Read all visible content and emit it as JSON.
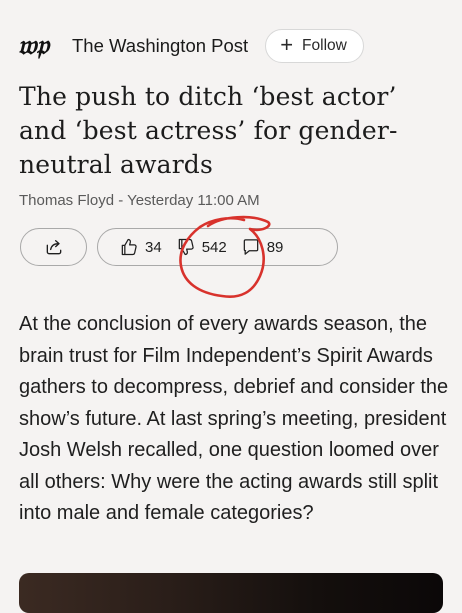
{
  "publisher": {
    "logo_text": "wp",
    "name": "The Washington Post",
    "follow_label": "Follow"
  },
  "article": {
    "headline": "The push to ditch ‘best actor’ and ‘best actress’ for gender-neutral awards",
    "byline": "Thomas Floyd - Yesterday 11:00 AM",
    "body": "At the conclusion of every awards season, the brain trust for Film Independent’s Spirit Awards gathers to decompress, debrief and consider the show’s future. At last spring’s meeting, president Josh Welsh recalled, one question loomed over all others: Why were the acting awards still split into male and female categories?"
  },
  "actions": {
    "likes": "34",
    "dislikes": "542",
    "comments": "89",
    "share_icon": "share-icon",
    "like_icon": "thumbs-up-icon",
    "dislike_icon": "thumbs-down-icon",
    "comment_icon": "comment-icon"
  },
  "colors": {
    "background": "#f5f3f2",
    "annotation_stroke": "#d8322c"
  }
}
